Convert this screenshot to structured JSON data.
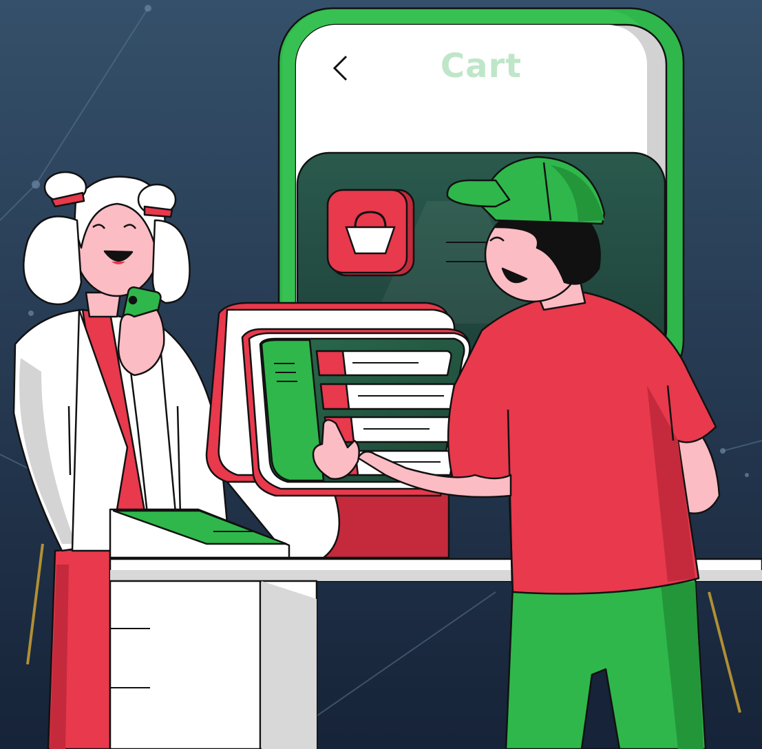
{
  "phone": {
    "title": "Cart",
    "back_icon": "chevron-left-icon",
    "cart_icon": "shopping-basket-icon"
  },
  "colors": {
    "background_top": "#35506a",
    "background_bottom": "#162338",
    "green": "#2fb74b",
    "green_dark": "#23963a",
    "red": "#e8394d",
    "red_dark": "#c42a3c",
    "skin": "#fbbcc4",
    "title_tint": "#bfe6c8"
  }
}
